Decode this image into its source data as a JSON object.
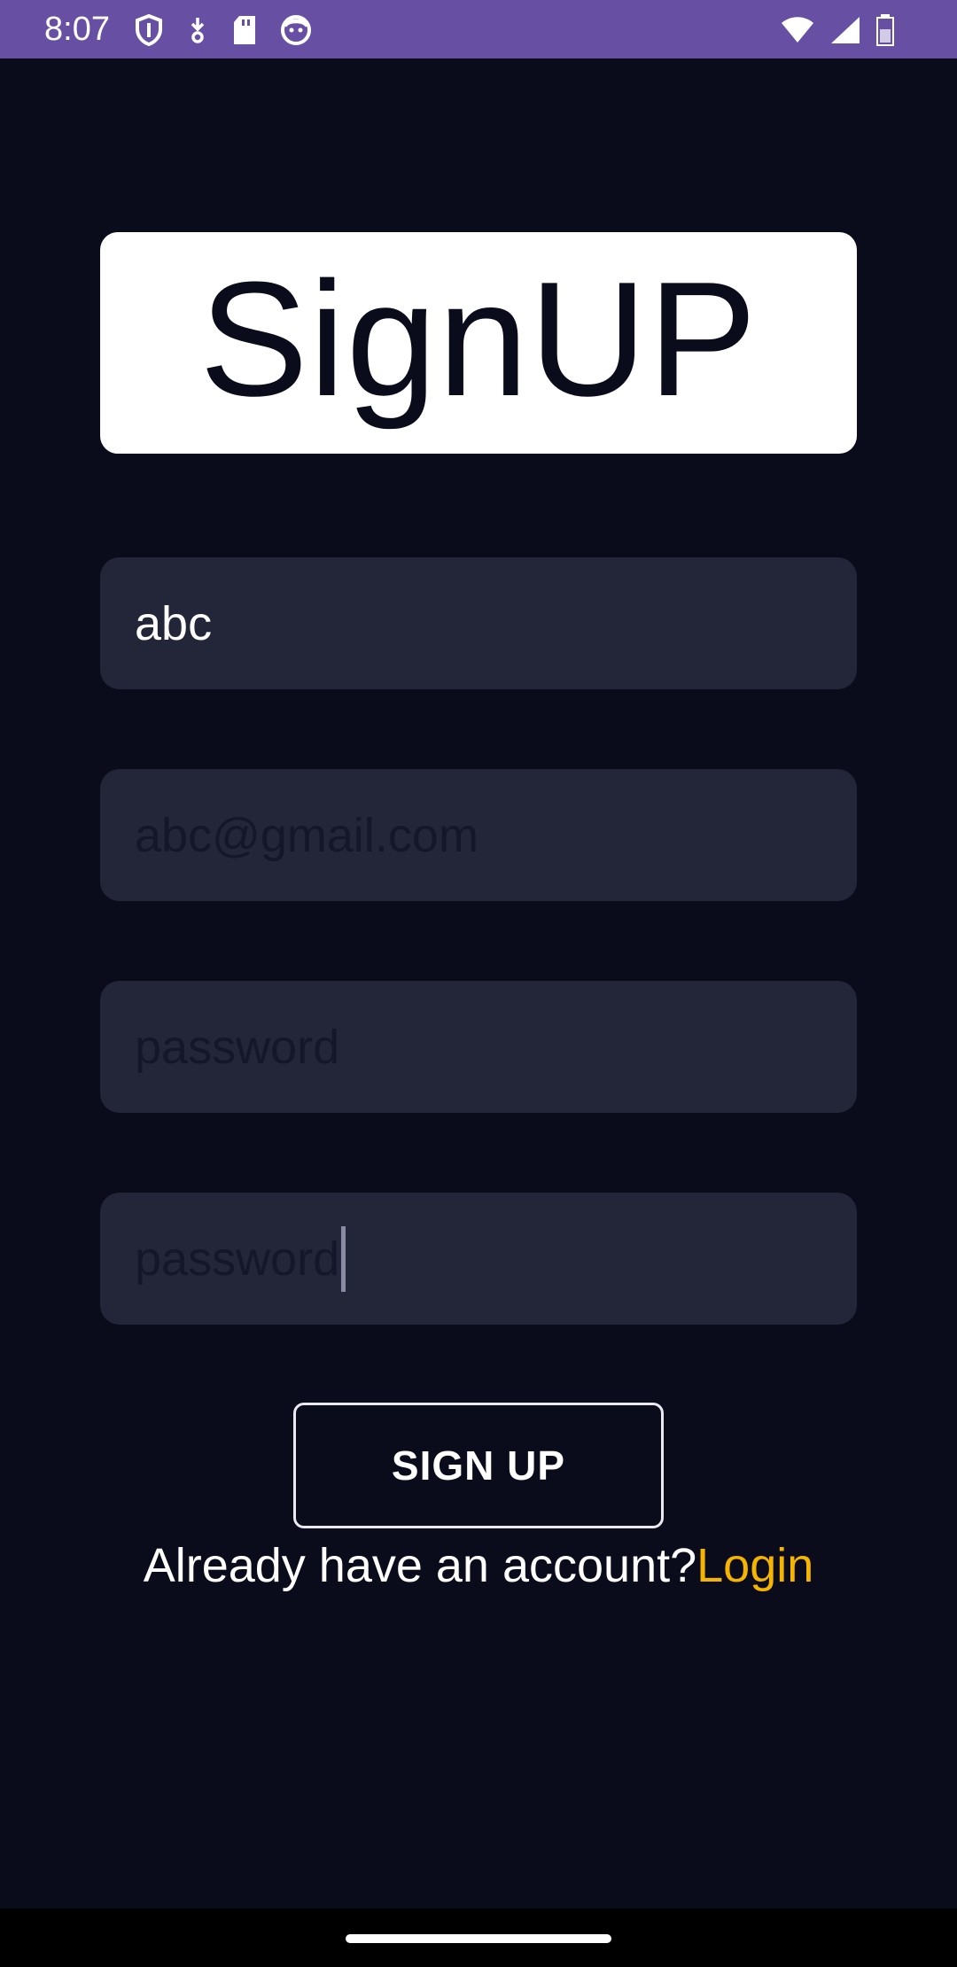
{
  "status_bar": {
    "time": "8:07",
    "icons_left": [
      "shield-icon",
      "download-icon",
      "sd-card-icon",
      "face-icon"
    ],
    "icons_right": [
      "wifi-icon",
      "signal-icon",
      "battery-icon"
    ],
    "color": "#6750a4"
  },
  "header": {
    "title": "SignUP"
  },
  "form": {
    "name_value": "abc",
    "email_placeholder": "abc@gmail.com",
    "password_placeholder": "password",
    "confirm_password_placeholder": "password",
    "submit_label": "SIGN UP"
  },
  "footer": {
    "prompt": "Already have an account?",
    "login_link": "Login",
    "link_color": "#f4b400"
  },
  "theme": {
    "background": "#0b0c1b",
    "field_background": "#232539"
  }
}
